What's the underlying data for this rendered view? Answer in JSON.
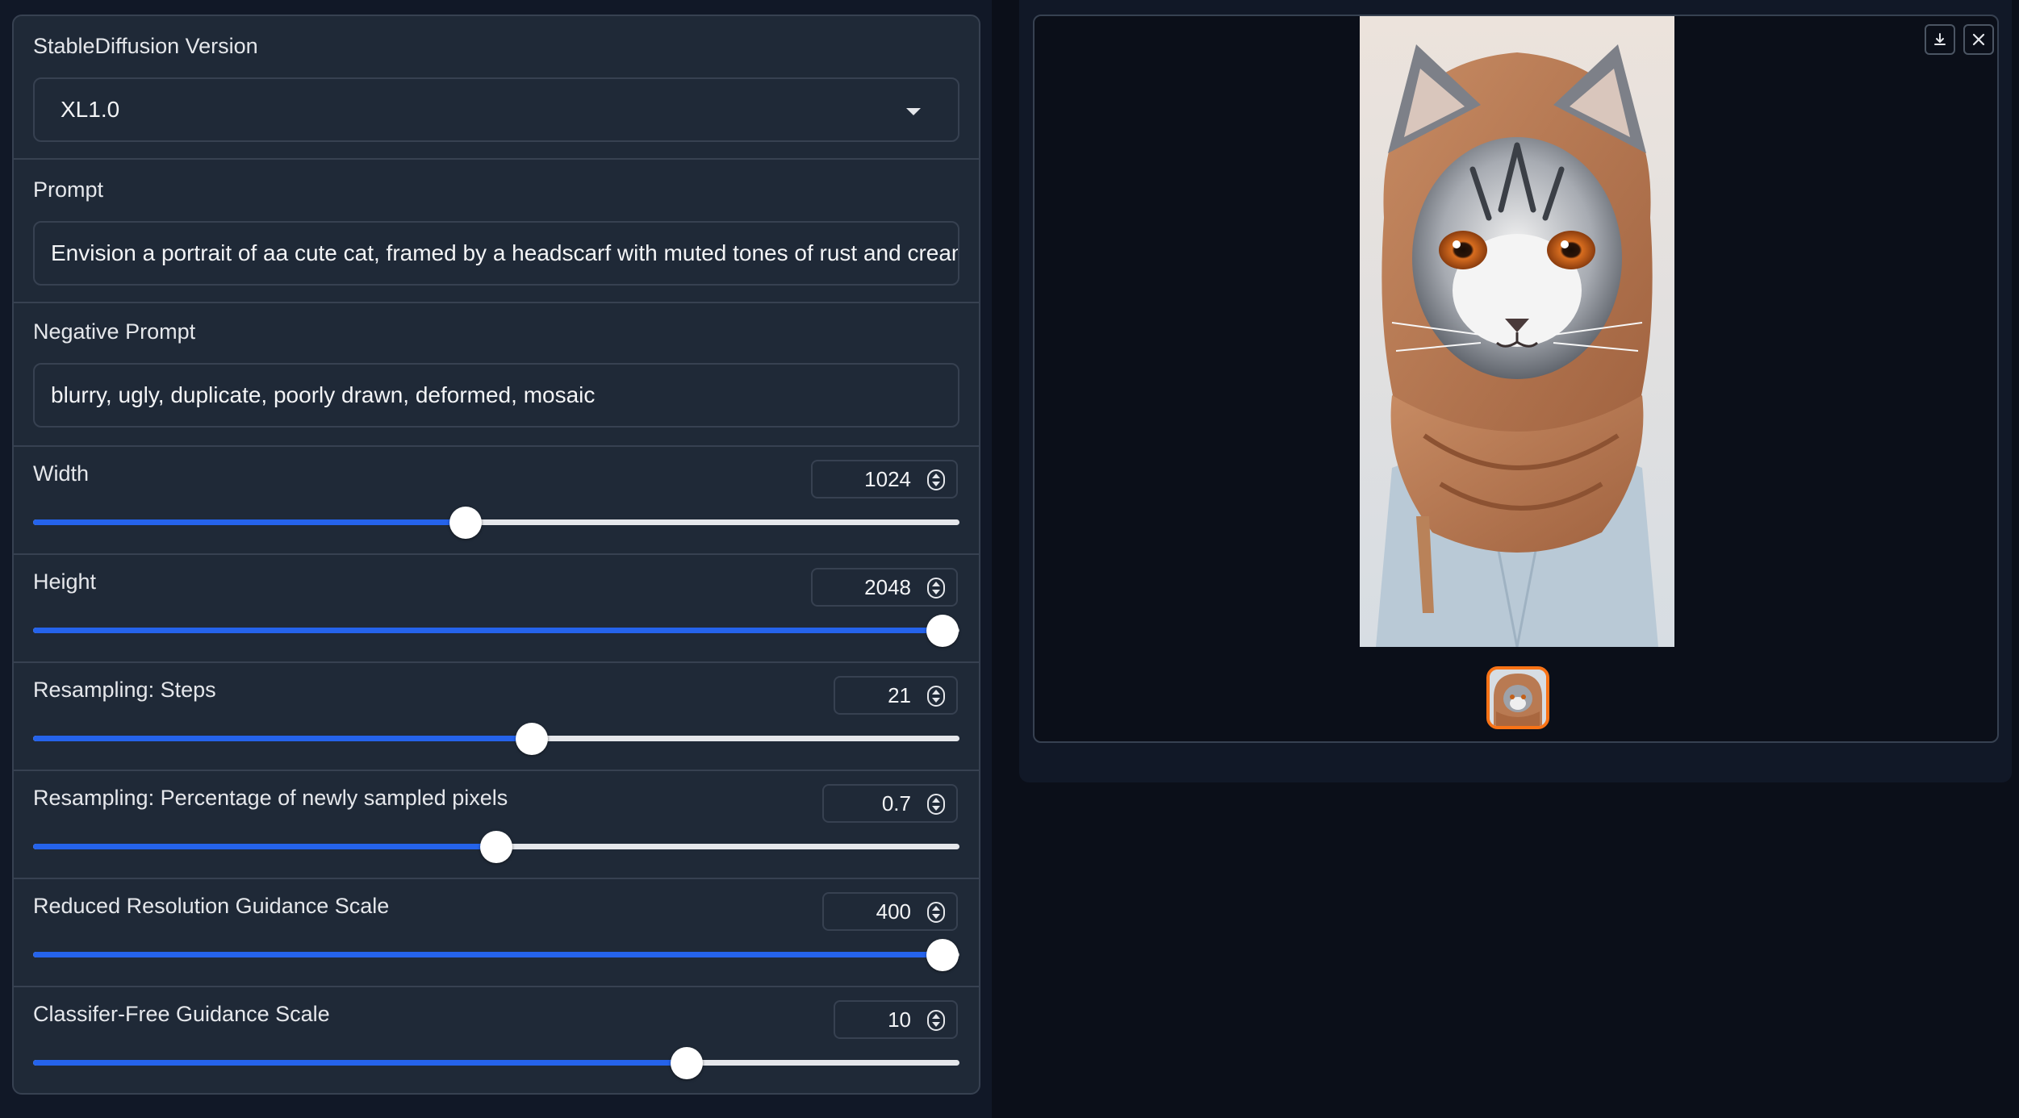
{
  "version_select": {
    "label": "StableDiffusion Version",
    "value": "XL1.0"
  },
  "prompt": {
    "label": "Prompt",
    "value": "Envision a portrait of aa cute cat, framed by a headscarf with muted tones of rust and cream. Ey"
  },
  "negative_prompt": {
    "label": "Negative Prompt",
    "value": "blurry, ugly, duplicate, poorly drawn, deformed, mosaic"
  },
  "sliders": [
    {
      "label": "Width",
      "value": "1024",
      "fraction": 0.467
    },
    {
      "label": "Height",
      "value": "2048",
      "fraction": 0.982
    },
    {
      "label": "Resampling: Steps",
      "value": "21",
      "fraction": 0.538
    },
    {
      "label": "Resampling: Percentage of newly sampled pixels",
      "value": "0.7",
      "fraction": 0.5
    },
    {
      "label": "Reduced Resolution Guidance Scale",
      "value": "400",
      "fraction": 0.982
    },
    {
      "label": "Classifer-Free Guidance Scale",
      "value": "10",
      "fraction": 0.706
    }
  ],
  "gallery": {
    "download_icon": "download-icon",
    "close_icon": "close-icon",
    "thumbnail_selected": true
  },
  "colors": {
    "accent": "#2563eb",
    "selected_border": "#f97316",
    "panel_bg": "#1f2937",
    "page_bg": "#0b0f19"
  }
}
